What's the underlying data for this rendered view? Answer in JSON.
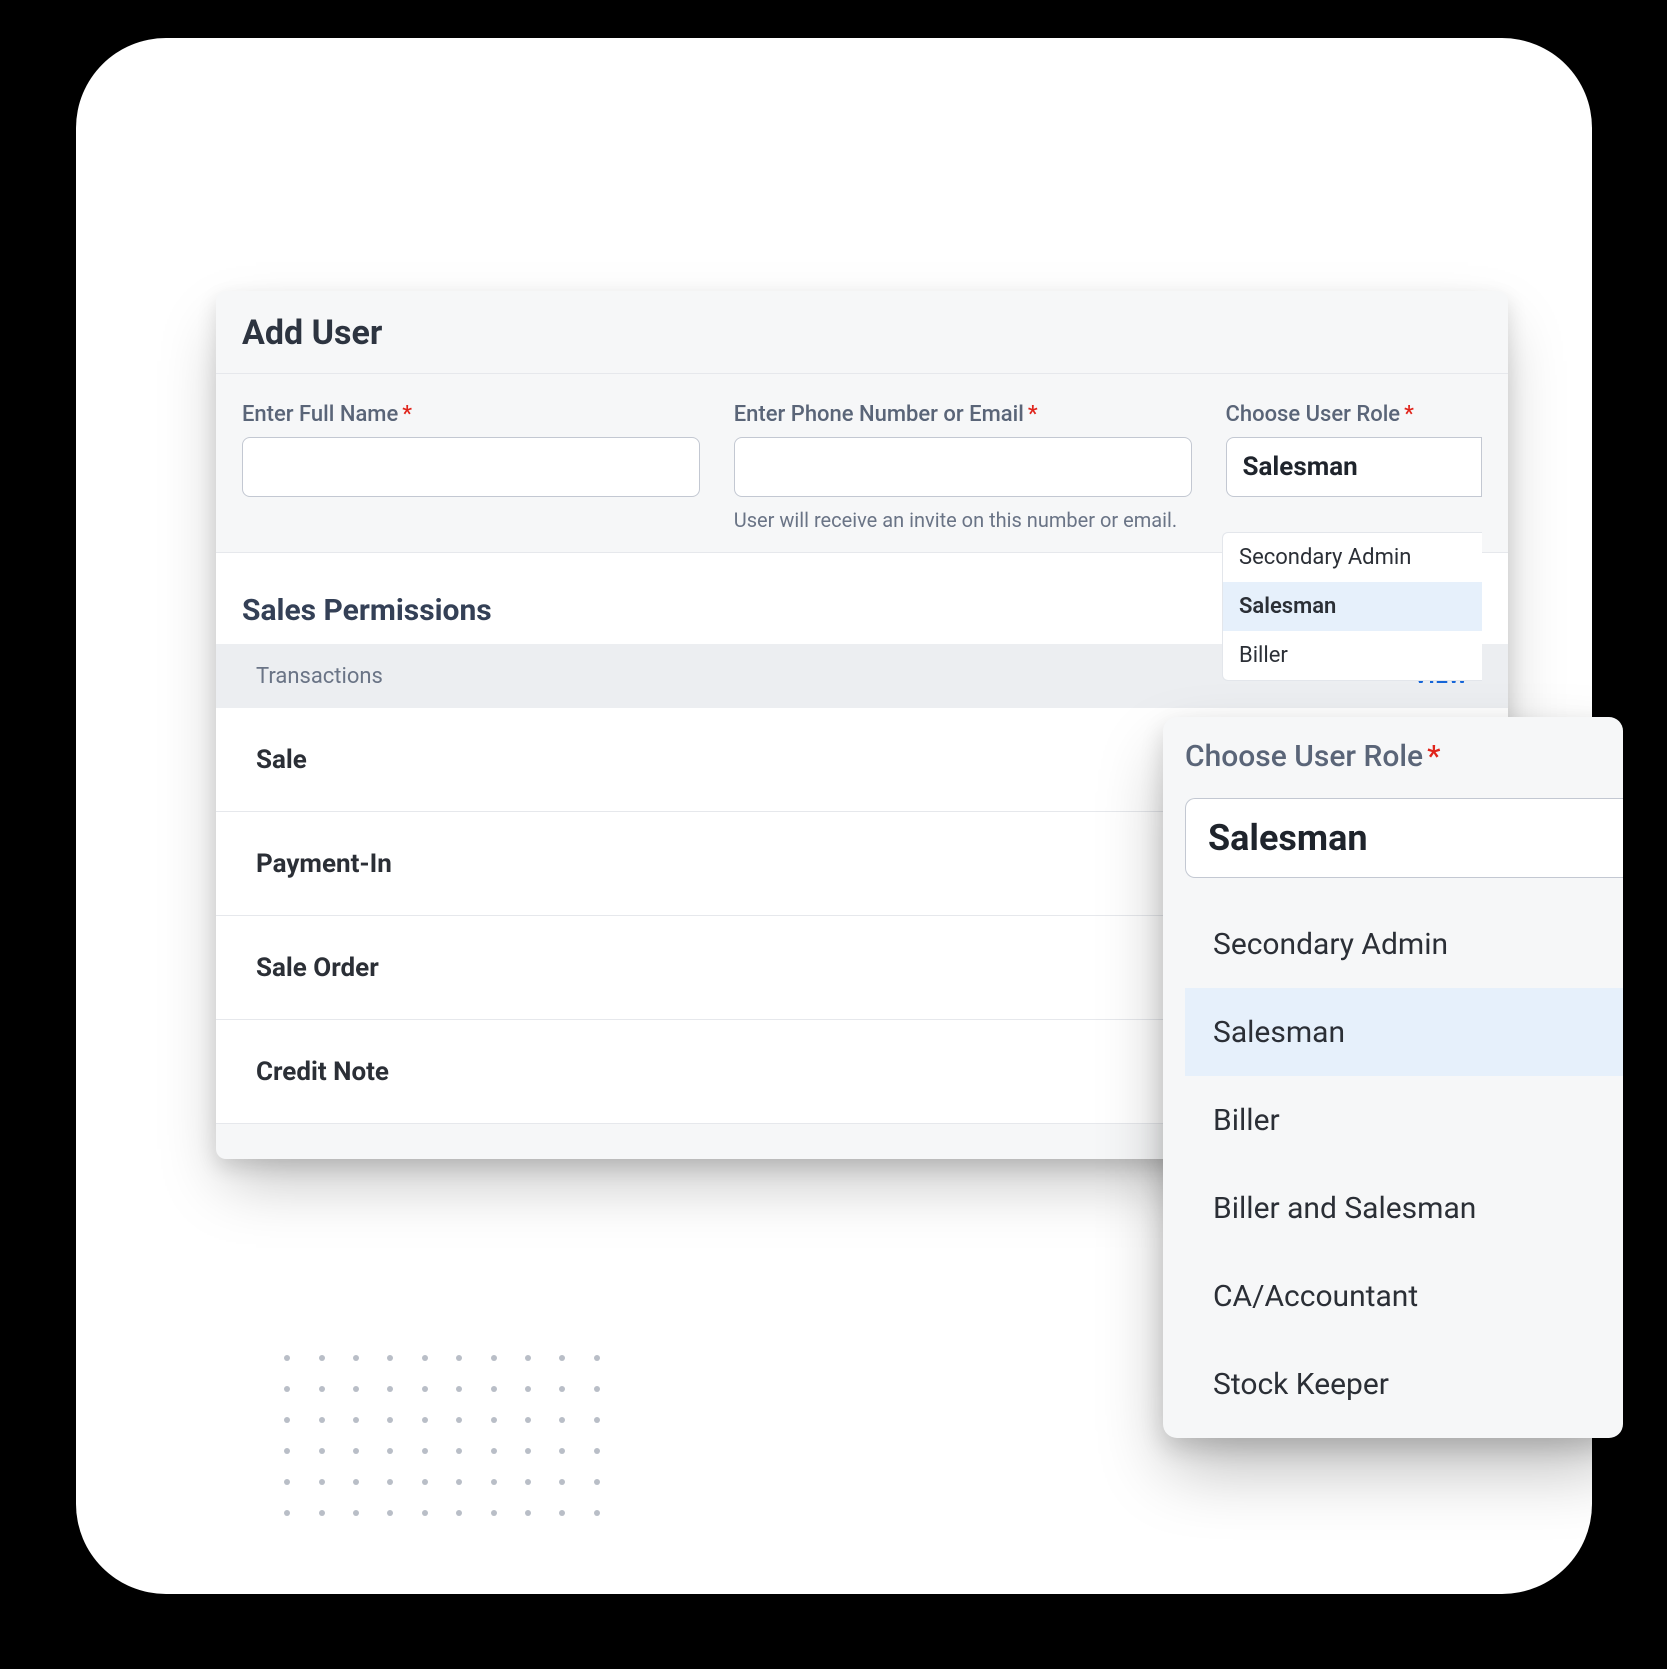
{
  "main": {
    "title": "Add User",
    "fields": {
      "fullname": {
        "label": "Enter Full Name",
        "value": ""
      },
      "phone": {
        "label": "Enter Phone Number or Email",
        "value": "",
        "help": "User will receive an invite on this number or email."
      },
      "role": {
        "label": "Choose User Role",
        "value": "Salesman"
      }
    },
    "role_options_back": [
      "Secondary Admin",
      "Salesman",
      "Biller"
    ],
    "permissions": {
      "section_title": "Sales Permissions",
      "col_transactions": "Transactions",
      "col_view": "VIEW",
      "rows": [
        "Sale",
        "Payment-In",
        "Sale Order",
        "Credit Note"
      ]
    }
  },
  "popover": {
    "label": "Choose User Role",
    "value": "Salesman",
    "options": [
      "Secondary Admin",
      "Salesman",
      "Biller",
      "Biller and Salesman",
      "CA/Accountant",
      "Stock Keeper"
    ],
    "selected": "Salesman"
  }
}
